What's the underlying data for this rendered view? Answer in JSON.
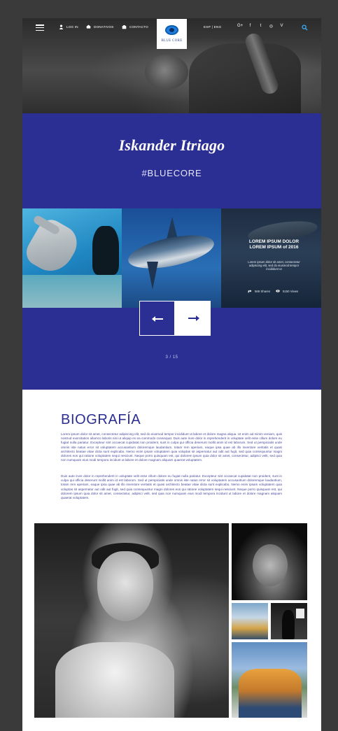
{
  "nav": {
    "login": "LOG IN",
    "donate": "DONATIVOS",
    "contact": "CONTACTO",
    "languages": "ESP  |  ENG",
    "social": [
      "G+",
      "f",
      "t",
      "◎",
      "V"
    ]
  },
  "brand": {
    "logo_text": "BLUE CORE"
  },
  "profile": {
    "name": "Iskander Itriago",
    "hashtag": "#BLUECORE"
  },
  "slider": {
    "featured": {
      "title": "LOREM IPSUM DOLOR LOREM IPSUM of 2016",
      "text": "Lorem ipsum dolor sit amet, consectetur adipiscing elit, sed do eiusmod tempor incididunt ut",
      "shares": "569 Shares",
      "views": "5150 Views"
    },
    "counter": "3 / 15"
  },
  "bio": {
    "title": "BIOGRAFÍA",
    "paragraph1": "Lorem ipsum dolor sit amet, consectetur adipiscing elit, sed do eiusmod tempor incididunt ut labore et dolore magna aliqua. Ut enim ad minim veniam, quis nostrud exercitation ullamco laboris nisi ut aliquip ex ea commodo consequat. Duis aute irure dolor in reprehenderit in voluptate velit esse cillum dolore eu fugiat nulla pariatur. Excepteur sint occaecat cupidatat non proident, sunt in culpa qui officia deserunt mollit anim id est laborum. Sed ut perspiciatis unde omnis iste natus error sit voluptatem accusantium doloremque laudantium, totam rem aperiam, eaque ipsa quae ab illo inventore veritatis et quasi architecto beatae vitae dicta sunt explicabo. Nemo enim ipsam voluptatem quia voluptas sit aspernatur aut odit aut fugit, sed quia consequuntur magni dolores eos qui ratione voluptatem sequi nesciunt. Neque porro quisquam est, qui dolorem ipsum quia dolor sit amet, consectetur, adipisci velit, sed quia non numquam eius modi tempora incidunt ut labore et dolore magnam aliquam quaerat voluptatem.",
    "paragraph2": "Duis aute irure dolor in reprehenderit in voluptate velit esse cillum dolore eu fugiat nulla pariatur. Excepteur sint occaecat cupidatat non proident, sunt in culpa qui officia deserunt mollit anim id est laborum. Sed ut perspiciatis unde omnis iste natus error sit voluptatem accusantium doloremque laudantium, totam rem aperiam, eaque ipsa quae ab illo inventore veritatis et quasi architecto beatae vitae dicta sunt explicabo. Nemo enim ipsam voluptatem quia voluptas sit aspernatur aut odit aut fugit, sed quia consequuntur magni dolores eos qui ratione voluptatem sequi nesciunt. Neque porro quisquam est, qui dolorem ipsum quia dolor sit amet, consectetur, adipisci velit, sed quia non numquam eius modi tempora incidunt ut labore et dolore magnam aliquam quaerat voluptatem."
  },
  "colors": {
    "brand_blue": "#2b2e92",
    "page_bg": "#3a3a3a"
  }
}
